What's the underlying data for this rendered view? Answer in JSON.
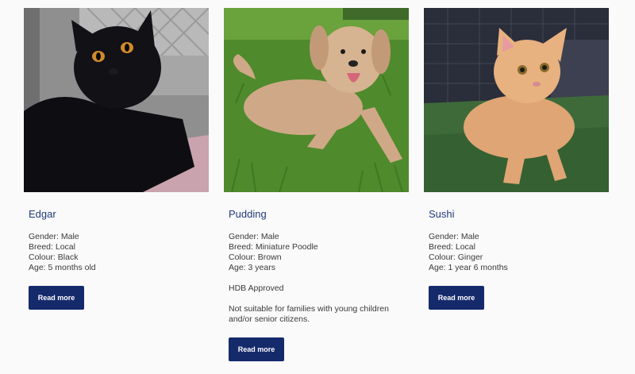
{
  "pets": [
    {
      "name": "Edgar",
      "gender": "Gender: Male",
      "breed": "Breed: Local",
      "colour": "Colour: Black",
      "age": "Age: 5 months old",
      "button_label": "Read more",
      "photo": "black-cat-photo"
    },
    {
      "name": "Pudding",
      "gender": "Gender: Male",
      "breed": "Breed: Miniature Poodle",
      "colour": "Colour: Brown",
      "age": "Age: 3 years",
      "note1": "HDB Approved",
      "note2": "Not suitable for families with young children and/or senior citizens.",
      "button_label": "Read more",
      "photo": "poodle-on-grass-photo"
    },
    {
      "name": "Sushi",
      "gender": "Gender: Male",
      "breed": "Breed: Local",
      "colour": "Colour: Ginger",
      "age": "Age: 1 year 6 months",
      "button_label": "Read more",
      "photo": "ginger-cat-photo"
    }
  ],
  "colors": {
    "accent": "#142a6b",
    "name_text": "#1f3a7a",
    "body_text": "#3a3a3a",
    "background": "#fafafa"
  }
}
